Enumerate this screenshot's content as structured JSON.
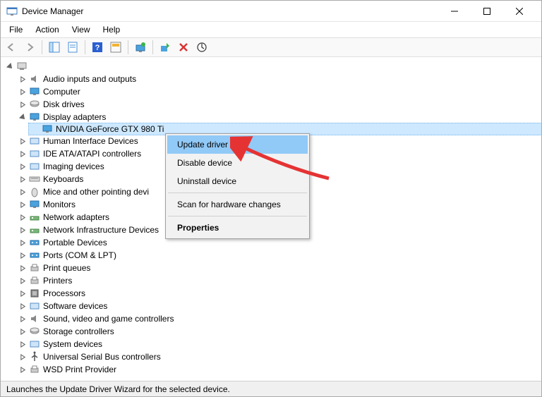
{
  "window": {
    "title": "Device Manager"
  },
  "menu": {
    "items": [
      "File",
      "Action",
      "View",
      "Help"
    ]
  },
  "tree": {
    "root": "",
    "categories": [
      {
        "label": "Audio inputs and outputs",
        "expanded": false
      },
      {
        "label": "Computer",
        "expanded": false
      },
      {
        "label": "Disk drives",
        "expanded": false
      },
      {
        "label": "Display adapters",
        "expanded": true,
        "children": [
          {
            "label": "NVIDIA GeForce GTX 980 Ti",
            "selected": true
          }
        ]
      },
      {
        "label": "Human Interface Devices",
        "expanded": false
      },
      {
        "label": "IDE ATA/ATAPI controllers",
        "expanded": false
      },
      {
        "label": "Imaging devices",
        "expanded": false
      },
      {
        "label": "Keyboards",
        "expanded": false
      },
      {
        "label": "Mice and other pointing devi",
        "expanded": false
      },
      {
        "label": "Monitors",
        "expanded": false
      },
      {
        "label": "Network adapters",
        "expanded": false
      },
      {
        "label": "Network Infrastructure Devices",
        "expanded": false
      },
      {
        "label": "Portable Devices",
        "expanded": false
      },
      {
        "label": "Ports (COM & LPT)",
        "expanded": false
      },
      {
        "label": "Print queues",
        "expanded": false
      },
      {
        "label": "Printers",
        "expanded": false
      },
      {
        "label": "Processors",
        "expanded": false
      },
      {
        "label": "Software devices",
        "expanded": false
      },
      {
        "label": "Sound, video and game controllers",
        "expanded": false
      },
      {
        "label": "Storage controllers",
        "expanded": false
      },
      {
        "label": "System devices",
        "expanded": false
      },
      {
        "label": "Universal Serial Bus controllers",
        "expanded": false
      },
      {
        "label": "WSD Print Provider",
        "expanded": false
      }
    ]
  },
  "context_menu": {
    "update": "Update driver",
    "disable": "Disable device",
    "uninstall": "Uninstall device",
    "scan": "Scan for hardware changes",
    "properties": "Properties"
  },
  "statusbar": {
    "text": "Launches the Update Driver Wizard for the selected device."
  }
}
